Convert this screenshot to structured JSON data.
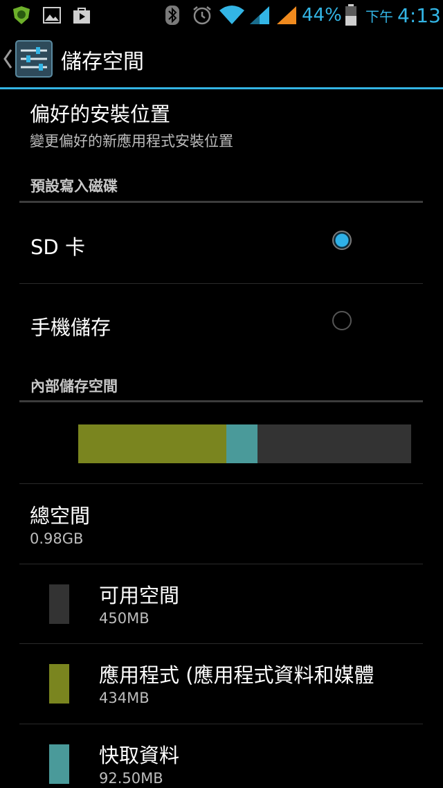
{
  "status_bar": {
    "battery_percent": "44%",
    "ampm": "下午",
    "time": "4:13",
    "icons": [
      "app-shield-icon",
      "image-icon",
      "store-bag-icon",
      "bluetooth-icon",
      "alarm-icon",
      "wifi-icon",
      "signal-icon",
      "signal-warning-icon",
      "battery-icon"
    ]
  },
  "action_bar": {
    "title": "儲存空間",
    "icon": "settings-sliders-icon",
    "accent": "#33b5e5"
  },
  "preferred_install": {
    "title": "偏好的安裝位置",
    "subtitle": "變更偏好的新應用程式安裝位置"
  },
  "default_disk": {
    "header": "預設寫入磁碟",
    "options": [
      {
        "label": "SD 卡",
        "selected": true
      },
      {
        "label": "手機儲存",
        "selected": false
      }
    ]
  },
  "internal_storage": {
    "header": "內部儲存空間",
    "usage_bar": {
      "total_mb": 976.5,
      "segments": [
        {
          "name": "apps",
          "mb": 434,
          "color": "#7a851f"
        },
        {
          "name": "cache",
          "mb": 92.5,
          "color": "#4a9a9a"
        },
        {
          "name": "free",
          "mb": 450,
          "color": "#333333"
        }
      ]
    },
    "total": {
      "title": "總空間",
      "value": "0.98GB"
    },
    "items": [
      {
        "label": "可用空間",
        "value": "450MB",
        "color": "#333333"
      },
      {
        "label": "應用程式 (應用程式資料和媒體",
        "value": "434MB",
        "color": "#7a851f"
      },
      {
        "label": "快取資料",
        "value": "92.50MB",
        "color": "#4a9a9a"
      }
    ]
  }
}
